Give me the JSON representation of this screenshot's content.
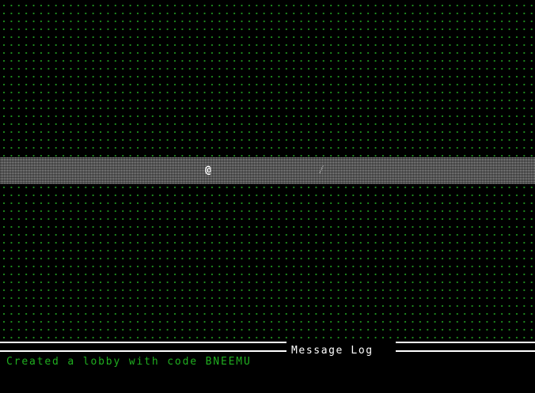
{
  "map": {
    "player_glyph": "@",
    "item_glyph": "/",
    "ground_color": "#1f8f1f",
    "road_color": "#9a9a9a"
  },
  "log": {
    "title": "Message Log",
    "messages": [
      "Created a lobby with code BNEEMU"
    ],
    "text_color": "#1fae1f"
  }
}
